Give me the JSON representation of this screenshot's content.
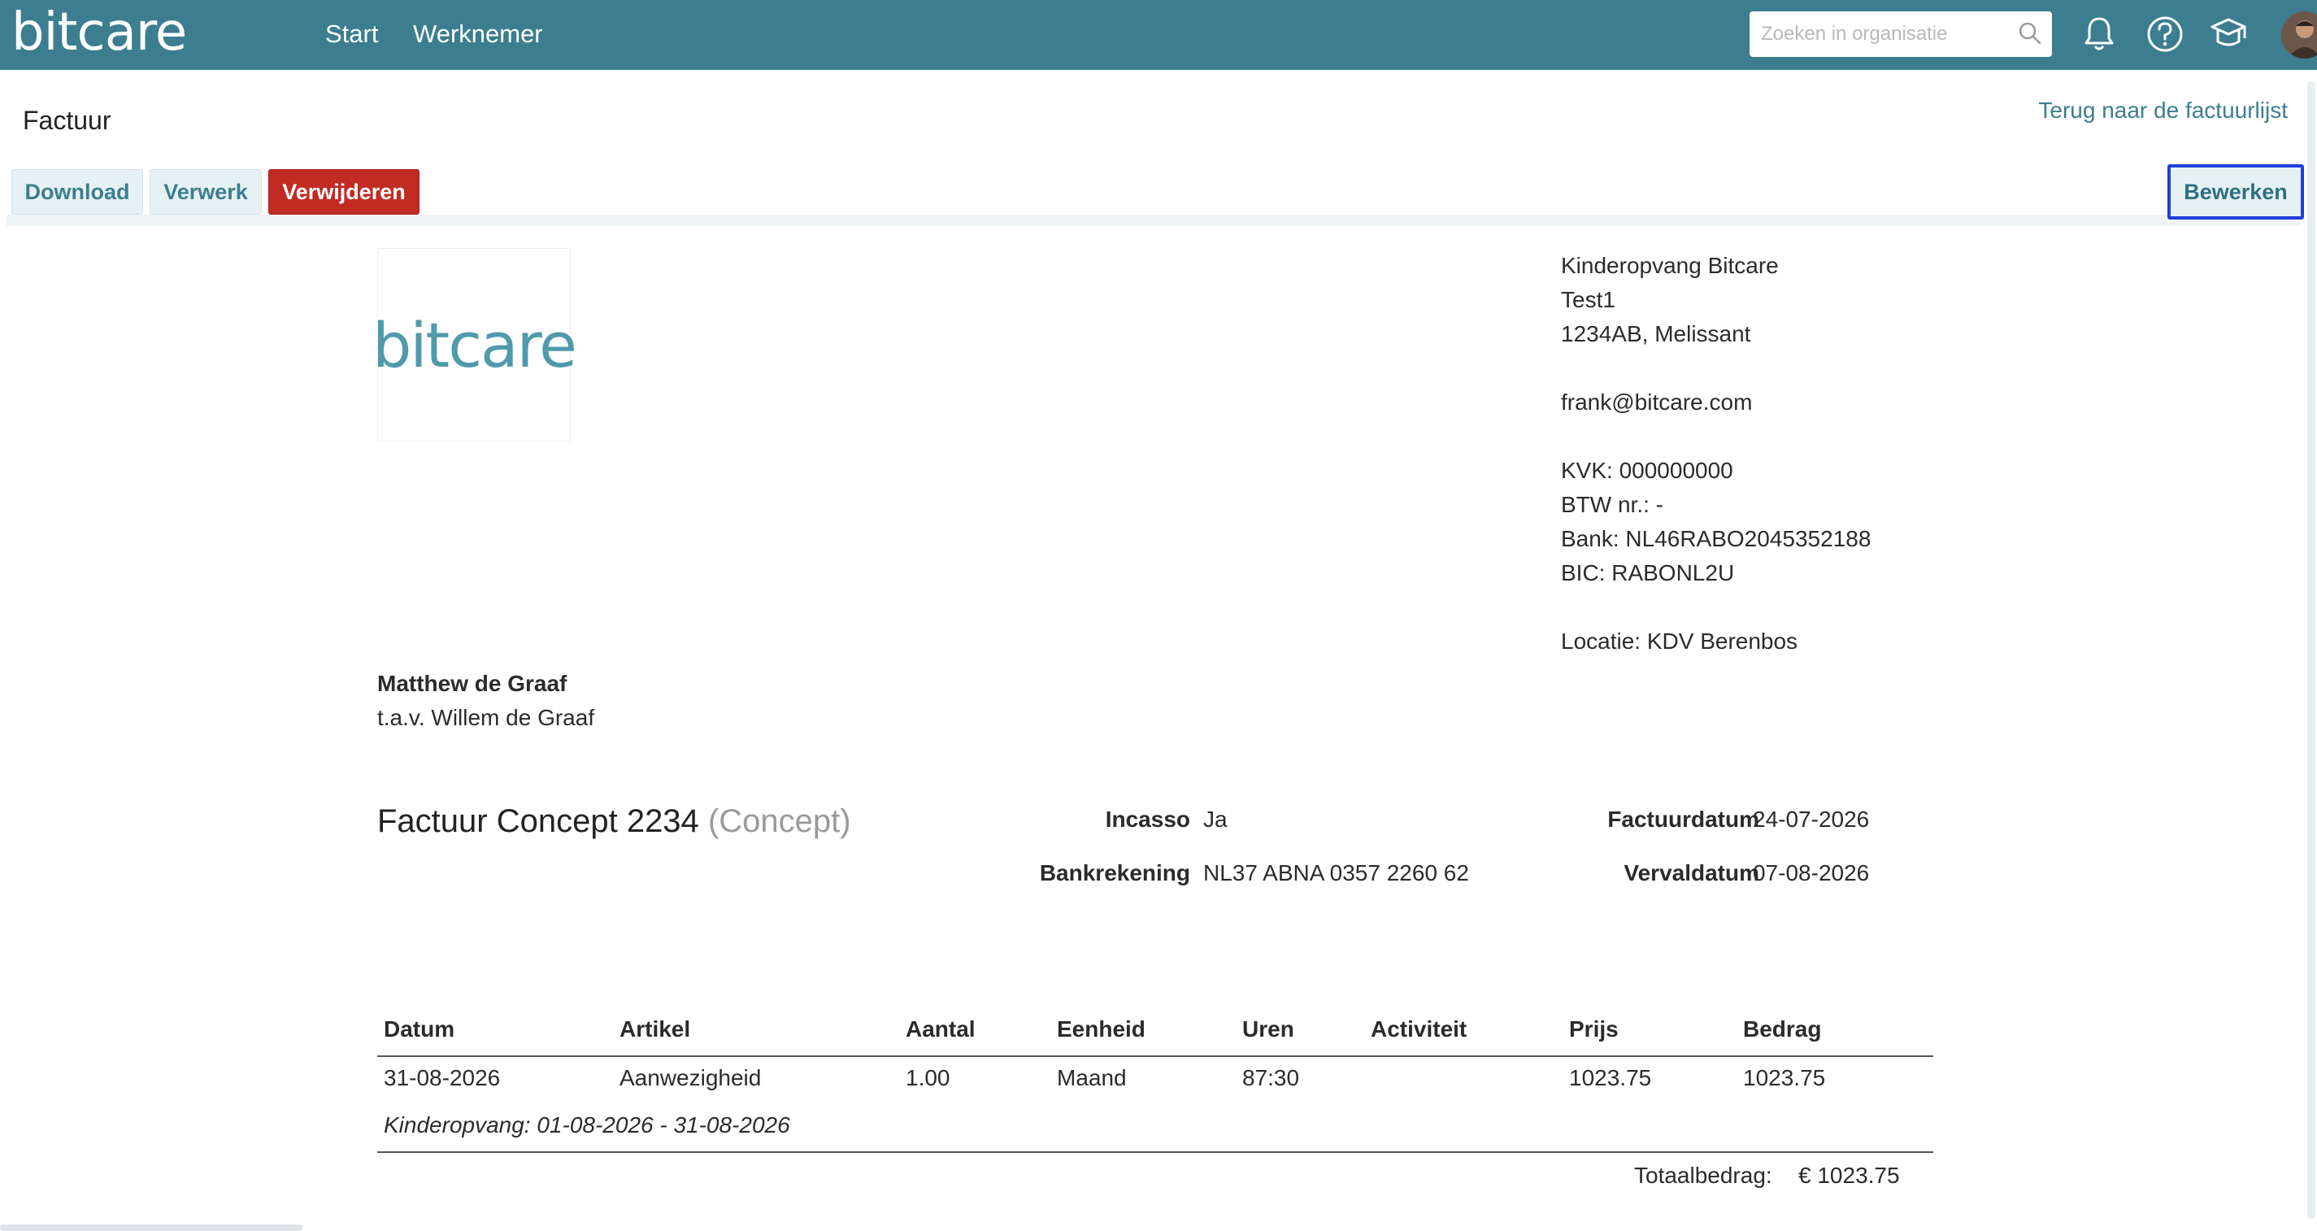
{
  "header": {
    "logo_text": "bitcare",
    "nav": [
      "Start",
      "Werknemer"
    ],
    "search_placeholder": "Zoeken in organisatie"
  },
  "page": {
    "title": "Factuur",
    "back_link": "Terug naar de factuurlijst"
  },
  "toolbar": {
    "download": "Download",
    "verwerk": "Verwerk",
    "verwijderen": "Verwijderen",
    "bewerken": "Bewerken"
  },
  "invoice": {
    "logo_text": "bitcare",
    "company": {
      "name": "Kinderopvang Bitcare",
      "street": "Test1",
      "city": "1234AB, Melissant",
      "email": "frank@bitcare.com",
      "kvk": "KVK: 000000000",
      "btw": "BTW nr.: -",
      "bank": "Bank: NL46RABO2045352188",
      "bic": "BIC: RABONL2U",
      "locatie": "Locatie: KDV Berenbos"
    },
    "recipient": {
      "name": "Matthew de Graaf",
      "tav": "t.a.v. Willem de Graaf"
    },
    "title": "Factuur Concept 2234",
    "status": "(Concept)",
    "meta": {
      "incasso_label": "Incasso",
      "incasso_value": "Ja",
      "bankrekening_label": "Bankrekening",
      "bankrekening_value": "NL37 ABNA 0357 2260 62",
      "factuurdatum_label": "Factuurdatum",
      "factuurdatum_value": "24-07-2026",
      "vervaldatum_label": "Vervaldatum",
      "vervaldatum_value": "07-08-2026"
    },
    "table": {
      "headers": [
        "Datum",
        "Artikel",
        "Aantal",
        "Eenheid",
        "Uren",
        "Activiteit",
        "Prijs",
        "Bedrag"
      ],
      "rows": [
        [
          "31-08-2026",
          "Aanwezigheid",
          "1.00",
          "Maand",
          "87:30",
          "",
          "1023.75",
          "1023.75"
        ]
      ],
      "period_note": "Kinderopvang: 01-08-2026 - 31-08-2026"
    },
    "total_label": "Totaalbedrag:",
    "total_value": "€ 1023.75"
  },
  "colors": {
    "topbar": "#3c7e8f",
    "danger": "#c12b23",
    "focus_outline": "#1f3ed6"
  },
  "icons": [
    "search-icon",
    "bell-icon",
    "help-icon",
    "graduation-cap-icon"
  ]
}
